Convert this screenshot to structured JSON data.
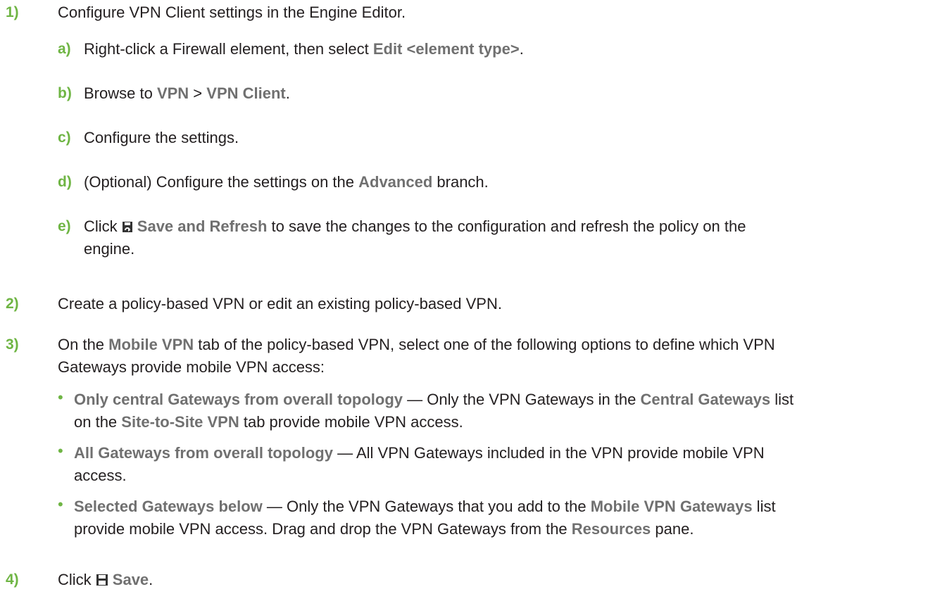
{
  "steps": [
    {
      "num": "1)",
      "text": "Configure VPN Client settings in the Engine Editor.",
      "substeps": [
        {
          "letter": "a)",
          "pre": "Right-click a Firewall element, then select ",
          "ui": "Edit <element type>",
          "post": "."
        },
        {
          "letter": "b)",
          "pre": "Browse to ",
          "ui1": "VPN",
          "sep": " > ",
          "ui2": "VPN Client",
          "post": "."
        },
        {
          "letter": "c)",
          "text": "Configure the settings."
        },
        {
          "letter": "d)",
          "pre": "(Optional) Configure the settings on the ",
          "ui": "Advanced",
          "post": " branch."
        },
        {
          "letter": "e)",
          "pre": "Click ",
          "icon": "save-refresh-icon",
          "ui": "Save and Refresh",
          "post": " to save the changes to the configuration and refresh the policy on the",
          "line2": "engine."
        }
      ]
    },
    {
      "num": "2)",
      "text": "Create a policy-based VPN or edit an existing policy-based VPN."
    },
    {
      "num": "3)",
      "pre": "On the ",
      "ui": "Mobile VPN",
      "post": " tab of the policy-based VPN, select one of the following options to define which VPN",
      "line2": "Gateways provide mobile VPN access:",
      "bullets": [
        {
          "ui": "Only central Gateways from overall topology",
          "mid": " — Only the VPN Gateways in the ",
          "ui2": "Central Gateways",
          "post": " list",
          "l2pre": "on the ",
          "l2ui": "Site-to-Site VPN",
          "l2post": " tab provide mobile VPN access."
        },
        {
          "ui": "All Gateways from overall topology",
          "mid": " — All VPN Gateways included in the VPN provide mobile VPN",
          "line2": "access."
        },
        {
          "ui": "Selected Gateways below",
          "mid": " — Only the VPN Gateways that you add to the ",
          "ui2": "Mobile VPN Gateways",
          "post": " list",
          "l2pre": "provide mobile VPN access. Drag and drop the VPN Gateways from the ",
          "l2ui": "Resources",
          "l2post": " pane."
        }
      ]
    },
    {
      "num": "4)",
      "pre": "Click ",
      "icon": "save-icon",
      "ui": "Save",
      "post": "."
    }
  ],
  "colors": {
    "accent": "#6fb544",
    "ui_text": "#707070",
    "body_text": "#231f20"
  }
}
